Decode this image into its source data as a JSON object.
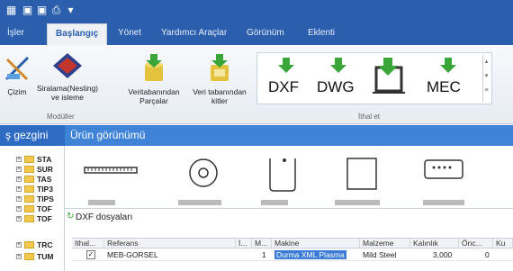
{
  "menu": {
    "items": [
      "İşler",
      "Başlangıç",
      "Yönet",
      "Yardımcı Araçlar",
      "Görünüm",
      "Eklenti"
    ],
    "active": "Başlangıç"
  },
  "ribbon": {
    "buttons": {
      "cizim": "Çizim",
      "siralama_1": "Siralama(Nesting)",
      "siralama_2": "ve isleme",
      "veritabanindan_1": "Veritabanından",
      "veritabanindan_2": "Parçalar",
      "veri_tabanindan_1": "Veri tabanından",
      "veri_tabanindan_2": "kitler",
      "dxf": "DXF",
      "dwg": "DWG",
      "mec": "MEC"
    },
    "groups": {
      "moduller": "Modüller",
      "ithal_et": "İthal et"
    }
  },
  "tabs": {
    "left": "ş gezgini",
    "right": "Ürün görünümü"
  },
  "tree": {
    "nodes": [
      "STA",
      "SUR",
      "TAS",
      "TIP3",
      "TIPS",
      "TOF",
      "TOF",
      "TRC",
      "TUM"
    ]
  },
  "panel": {
    "title": "DXF dosyaları"
  },
  "grid": {
    "headers": [
      "Ithal...",
      "Referans",
      "İ...",
      "M...",
      "Makine",
      "Malzeme",
      "Kalınlık",
      "Önc...",
      "Ku"
    ],
    "rows": [
      {
        "referans": "MEB-GORSEL",
        "m": "1",
        "makine": "Durma XML Plasma",
        "malzeme": "Mild Steel",
        "kalinlik": "3,000",
        "onc": "0"
      }
    ]
  },
  "colors": {
    "titlebar": "#2b5fae",
    "tabbar": "#2e6bc2",
    "selection": "#3a7bd5",
    "arrow_green": "#3aa63a"
  }
}
